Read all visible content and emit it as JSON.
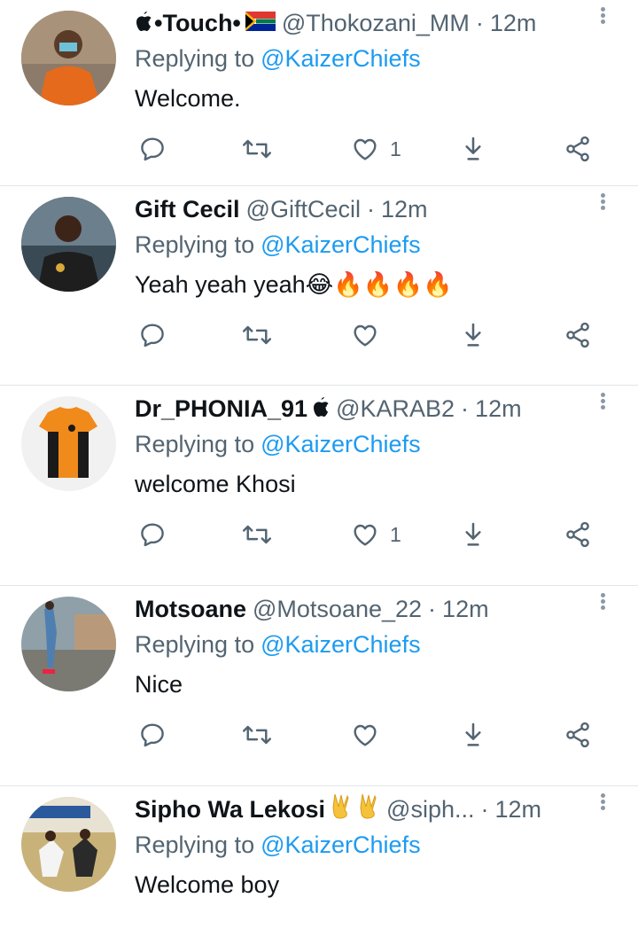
{
  "tweets": [
    {
      "name": "•Touch•",
      "handle": "@Thokozani_MM",
      "time": "12m",
      "replying_prefix": "Replying to",
      "replying_to": "@KaizerChiefs",
      "text": "Welcome.",
      "likes": "1"
    },
    {
      "name": "Gift Cecil",
      "handle": "@GiftCecil",
      "time": "12m",
      "replying_prefix": "Replying to",
      "replying_to": "@KaizerChiefs",
      "text": "Yeah yeah yeah😂🔥🔥🔥🔥",
      "likes": ""
    },
    {
      "name": "Dr_PHONIA_91",
      "handle": "@KARAB2",
      "time": "12m",
      "replying_prefix": "Replying to",
      "replying_to": "@KaizerChiefs",
      "text": "welcome Khosi",
      "likes": "1"
    },
    {
      "name": "Motsoane",
      "handle": "@Motsoane_22",
      "time": "12m",
      "replying_prefix": "Replying to",
      "replying_to": "@KaizerChiefs",
      "text": "Nice",
      "likes": ""
    },
    {
      "name": "Sipho Wa Lekosi",
      "handle": "@siph...",
      "time": "12m",
      "replying_prefix": "Replying to",
      "replying_to": "@KaizerChiefs",
      "text": "Welcome boy",
      "likes": ""
    }
  ],
  "separator": "·",
  "icons": {
    "reply": "reply-icon",
    "retweet": "retweet-icon",
    "like": "heart-icon",
    "share": "share-download-icon",
    "more": "more-vertical-icon"
  },
  "colors": {
    "text": "#0f1419",
    "secondary": "#536471",
    "link": "#1d9bf0",
    "divider": "#e1e6ea"
  }
}
